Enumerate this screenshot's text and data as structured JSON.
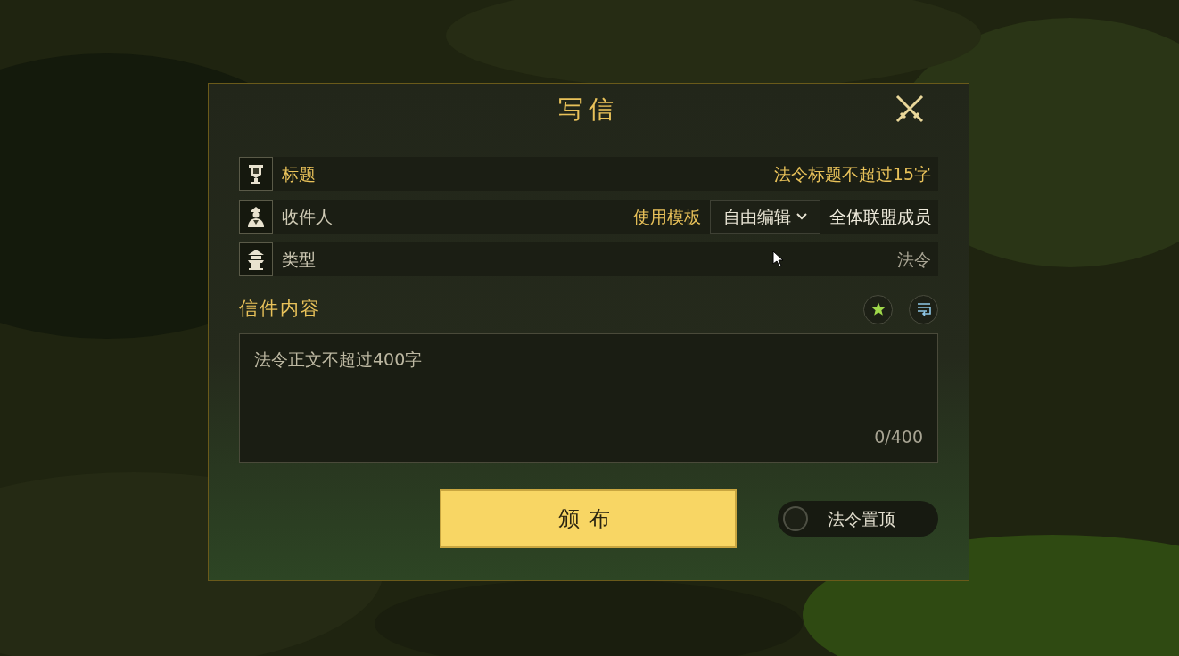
{
  "dialog": {
    "title": "写信"
  },
  "fields": [
    {
      "kind": "text",
      "label": "标题",
      "placeholder": "法令标题不超过15字"
    },
    {
      "kind": "recipient",
      "label": "收件人",
      "template_label": "使用模板",
      "template": "自由编辑",
      "value": "全体联盟成员"
    },
    {
      "kind": "static",
      "label": "类型",
      "value": "法令"
    }
  ],
  "content": {
    "label": "信件内容",
    "placeholder": "法令正文不超过400字",
    "counter": "0/400"
  },
  "submit": "颁布",
  "pin_toggle": {
    "label": "法令置顶",
    "on": false
  }
}
